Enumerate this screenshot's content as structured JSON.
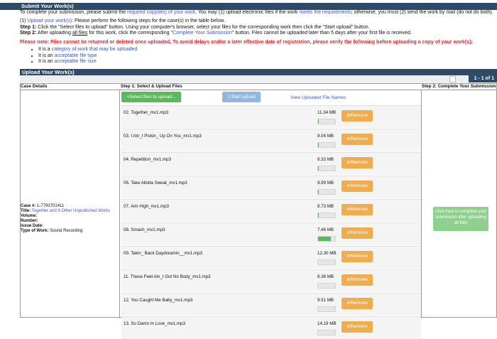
{
  "submit_section": {
    "title": "Submit Your Work(s)",
    "intro_pre": "To complete your submission, please submit the ",
    "intro_link1": "required copy(ies) of your work",
    "intro_mid": ". You may (1) upload electronic files if the work ",
    "intro_link2": "meets the requirements",
    "intro_post": "; otherwise, you must (2) send the work by mail (do not do both).",
    "option1_pre": "(1) ",
    "option1_link": "Upload your work(s)",
    "option1_post": ": Please perform the following steps for the case(s) in the table below.",
    "step1_label": "Step 1:",
    "step1_text": " Click the \"Select files to upload\" button. Using your computer's browser, select your files for the corresponding work then click the \"Start upload\" button.",
    "step2_label": "Step 2:",
    "step2_pre": " After uploading ",
    "step2_underline": "all files",
    "step2_mid": " for this work, click the corresponding \"",
    "step2_link": "Complete Your Submission",
    "step2_post": "\" button. Files cannot be uploaded later than 5 days after your first file is received.",
    "warning": "Please note: Files cannot be returned or deleted once uploaded. To avoid delays and/or a later effective date of registration, please verify the following before uploading a copy of your work(s):",
    "checklist": [
      {
        "pre": "It is a ",
        "link": "category of work that may be uploaded"
      },
      {
        "pre": "It is an ",
        "link": "acceptable file type"
      },
      {
        "pre": "It is an ",
        "link": "acceptable file size"
      }
    ]
  },
  "upload_section": {
    "title": "Upload Your Work(s)",
    "pager": "1 - 1 of 1",
    "headers": {
      "case_details": "Case Details",
      "step1": "Step 1: Select & Upload Files",
      "step2": "Step 2: Complete Your Submission"
    },
    "case": {
      "case_label": "Case #:",
      "case_value": " 1-7793701411",
      "title_label": "Title:",
      "title_value": "Together and 9 Other Unpublished Works",
      "volume_label": "Volume:",
      "number_label": "Number:",
      "issue_label": "Issue Date:",
      "type_label": "Type of Work:",
      "type_value": " Sound Recording"
    },
    "select_button": "+Select files to upload...",
    "start_button": "⇧Start upload",
    "view_link": "View Uploaded File Names",
    "remove_label": "⊘Remove",
    "files": [
      {
        "name": "02. Together_mv1.mp3",
        "size": "11.34 MB",
        "progress": 0.05
      },
      {
        "name": "03. I Ain_t Pickin_ Up On You_mv1.mp3",
        "size": "8.04 MB",
        "progress": 0.05
      },
      {
        "name": "04. Repetition_mv1.mp3",
        "size": "8.33 MB",
        "progress": 0.05
      },
      {
        "name": "06. Take Allotta Sweat_mv1.mp3",
        "size": "9.99 MB",
        "progress": 0.05
      },
      {
        "name": "07. Aim High_mv1.mp3",
        "size": "8.73 MB",
        "progress": 0.05
      },
      {
        "name": "08. Smash_mv1.mp3",
        "size": "7.46 MB",
        "progress": 0.75
      },
      {
        "name": "09. Takin_ Back Daydreamin__mv1.mp3",
        "size": "12.30 MB",
        "progress": 0
      },
      {
        "name": "11. These Feet Ain_t Got No Body_mv1.mp3",
        "size": "8.36 MB",
        "progress": 0
      },
      {
        "name": "12. You Caught Me Baby_mv1.mp3",
        "size": "9.51 MB",
        "progress": 0
      },
      {
        "name": "13. So Damn In Love_mv1.mp3",
        "size": "14.19 MB",
        "progress": 0
      }
    ],
    "complete_button": "Click here to complete your submission after uploading all files"
  },
  "colors": {
    "header_bar": "#2d4a66",
    "link": "#3b56c9",
    "warning": "#e3262b",
    "select_button": "#5cb85c",
    "start_button": "#8fb7df",
    "remove_button": "#f0ad4e",
    "complete_button": "#8ed08e"
  }
}
